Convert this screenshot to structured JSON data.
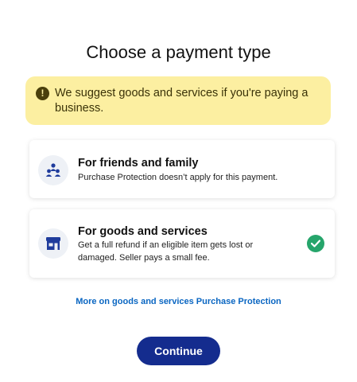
{
  "page": {
    "title": "Choose a payment type"
  },
  "alert": {
    "icon": "exclamation-circle-icon",
    "message": "We suggest goods and services if you're paying a business.",
    "background": "#fcefa1"
  },
  "options": [
    {
      "id": "friends-family",
      "icon": "people-group-icon",
      "title": "For friends and family",
      "description": "Purchase Protection doesn’t apply for this payment.",
      "selected": false
    },
    {
      "id": "goods-services",
      "icon": "storefront-icon",
      "title": "For goods and services",
      "description": "Get a full refund if an eligible item gets lost or damaged. Seller pays a small fee.",
      "selected": true,
      "selected_icon": "checkmark-circle-icon",
      "selected_color": "#26a56b"
    }
  ],
  "link": {
    "label": "More on goods and services Purchase Protection",
    "color": "#0a66c2"
  },
  "actions": {
    "continue_label": "Continue",
    "continue_color": "#142c8e"
  }
}
